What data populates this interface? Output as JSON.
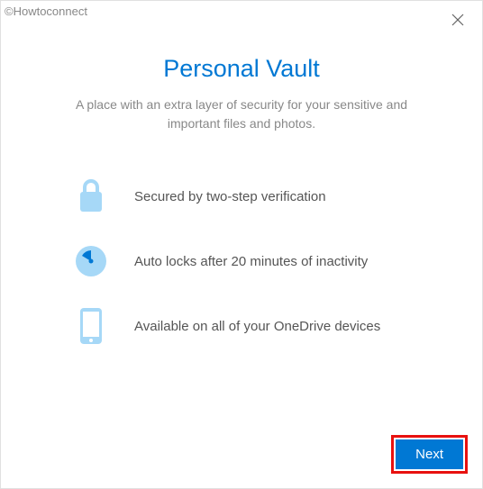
{
  "watermark": "©Howtoconnect",
  "title": "Personal Vault",
  "subtitle": "A place with an extra layer of security for your sensitive and important files and photos.",
  "features": [
    {
      "text": "Secured by two-step verification"
    },
    {
      "text": "Auto locks after 20 minutes of inactivity"
    },
    {
      "text": "Available on all of your OneDrive devices"
    }
  ],
  "buttons": {
    "next": "Next"
  },
  "colors": {
    "accent": "#0078d4",
    "iconLight": "#a6d8f7",
    "highlight": "#e8110f"
  }
}
